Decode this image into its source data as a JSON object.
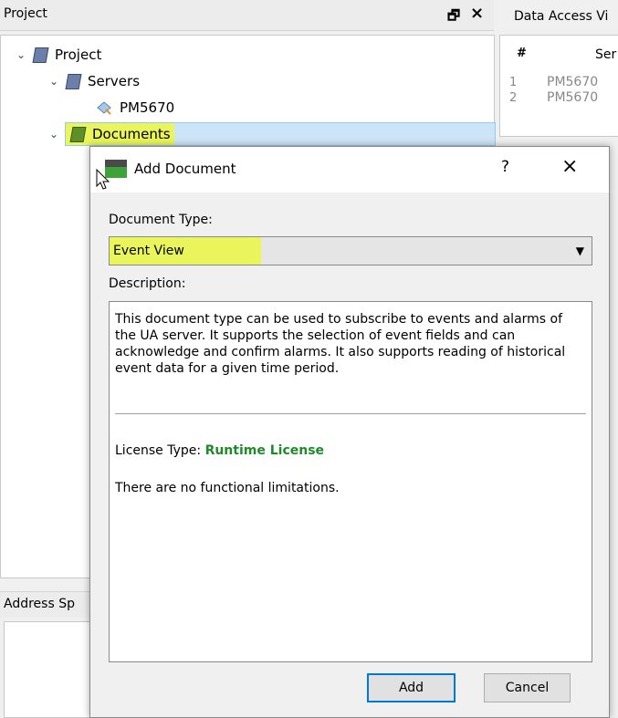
{
  "project_panel": {
    "title": "Project",
    "pin_icon": "pin-icon",
    "close_icon": "close-icon",
    "tree": [
      {
        "label": "Project",
        "expanded": true
      },
      {
        "label": "Servers",
        "expanded": true
      },
      {
        "label": "PM5670"
      },
      {
        "label": "Documents",
        "expanded": true,
        "selected": true
      }
    ]
  },
  "address_panel": {
    "title": "Address Sp"
  },
  "data_panel": {
    "title": "Data Access Vi",
    "columns": [
      "#",
      "Ser"
    ],
    "rows": [
      {
        "num": "1",
        "value": "PM5670"
      },
      {
        "num": "2",
        "value": "PM5670"
      }
    ]
  },
  "dialog": {
    "title": "Add Document",
    "help_label": "?",
    "close_label": "×",
    "document_type_label": "Document Type:",
    "document_type_value": "Event View",
    "description_label": "Description:",
    "description_text": "This document type can be used to subscribe to events and alarms of the UA server. It supports the selection of event fields and can acknowledge and confirm alarms. It also supports reading of historical event data for a given time period.",
    "license_label": "License Type:",
    "license_value": "Runtime License",
    "limitations_text": "There are no functional limitations.",
    "add_button": "Add",
    "cancel_button": "Cancel"
  },
  "colors": {
    "highlight": "#e9f55a",
    "license_green": "#1f8a2a",
    "selection": "#cce4f7",
    "default_button_border": "#0078d7"
  }
}
